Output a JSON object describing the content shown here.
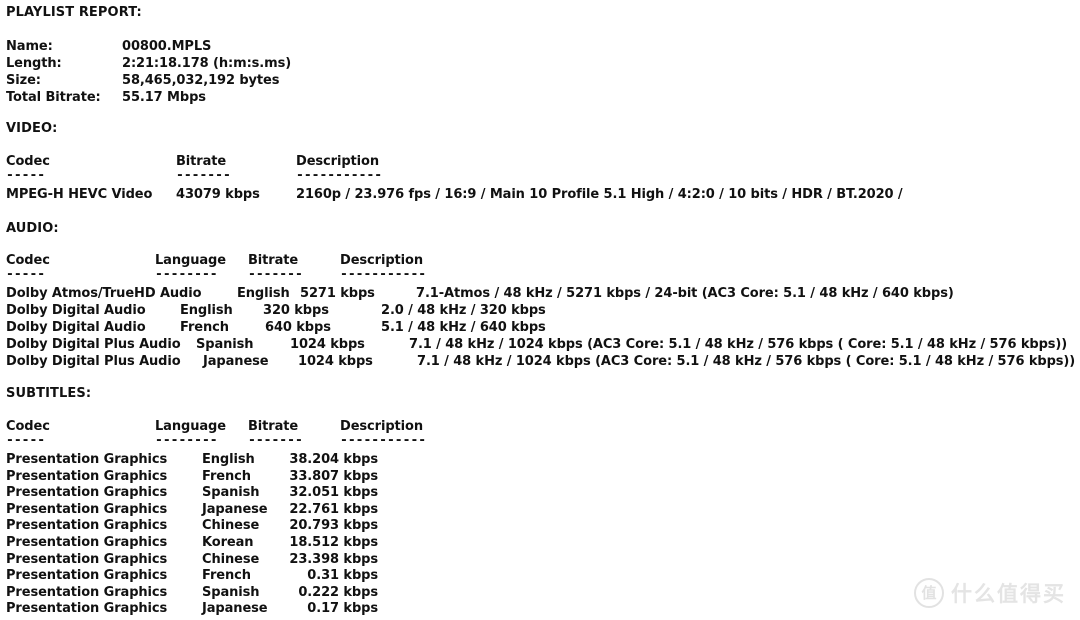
{
  "report": {
    "title": "PLAYLIST REPORT:",
    "info": [
      {
        "label": "Name:",
        "value": "00800.MPLS"
      },
      {
        "label": "Length:",
        "value": "2:21:18.178 (h:m:s.ms)"
      },
      {
        "label": "Size:",
        "value": "58,465,032,192 bytes"
      },
      {
        "label": "Total Bitrate:",
        "value": "55.17 Mbps"
      }
    ],
    "video": {
      "section_label": "VIDEO:",
      "headers": {
        "codec": "Codec",
        "bitrate": "Bitrate",
        "description": "Description"
      },
      "rules": {
        "codec": "-----",
        "bitrate": "-------",
        "description": "-----------"
      },
      "rows": [
        {
          "codec": "MPEG-H HEVC Video",
          "bitrate": "43079 kbps",
          "description": "2160p / 23.976 fps / 16:9 / Main 10 Profile 5.1 High / 4:2:0 / 10 bits / HDR / BT.2020 /"
        }
      ]
    },
    "audio": {
      "section_label": "AUDIO:",
      "headers": {
        "codec": "Codec",
        "language": "Language",
        "bitrate": "Bitrate",
        "description": "Description"
      },
      "rules": {
        "codec": "-----",
        "language": "--------",
        "bitrate": "-------",
        "description": "-----------"
      },
      "rows": [
        {
          "codec": "Dolby Atmos/TrueHD Audio",
          "language": "English",
          "bitrate": "5271 kbps",
          "description": "7.1-Atmos / 48 kHz / 5271 kbps / 24-bit (AC3 Core: 5.1 / 48 kHz / 640 kbps)"
        },
        {
          "codec": "Dolby Digital Audio",
          "language": "English",
          "bitrate": "320 kbps",
          "description": "2.0 / 48 kHz / 320 kbps"
        },
        {
          "codec": "Dolby Digital Audio",
          "language": "French",
          "bitrate": "640 kbps",
          "description": "5.1 / 48 kHz / 640 kbps"
        },
        {
          "codec": "Dolby Digital Plus Audio",
          "language": "Spanish",
          "bitrate": "1024 kbps",
          "description": "7.1 / 48 kHz / 1024 kbps (AC3 Core: 5.1 / 48 kHz / 576 kbps ( Core: 5.1 / 48 kHz / 576 kbps))"
        },
        {
          "codec": "Dolby Digital Plus Audio",
          "language": "Japanese",
          "bitrate": "1024 kbps",
          "description": "7.1 / 48 kHz / 1024 kbps (AC3 Core: 5.1 / 48 kHz / 576 kbps ( Core: 5.1 / 48 kHz / 576 kbps))"
        }
      ]
    },
    "subtitles": {
      "section_label": "SUBTITLES:",
      "headers": {
        "codec": "Codec",
        "language": "Language",
        "bitrate": "Bitrate",
        "description": "Description"
      },
      "rules": {
        "codec": "-----",
        "language": "--------",
        "bitrate": "-------",
        "description": "-----------"
      },
      "rows": [
        {
          "codec": "Presentation Graphics",
          "language": "English",
          "bitrate": "38.204 kbps",
          "description": ""
        },
        {
          "codec": "Presentation Graphics",
          "language": "French",
          "bitrate": "33.807 kbps",
          "description": ""
        },
        {
          "codec": "Presentation Graphics",
          "language": "Spanish",
          "bitrate": "32.051 kbps",
          "description": ""
        },
        {
          "codec": "Presentation Graphics",
          "language": "Japanese",
          "bitrate": "22.761 kbps",
          "description": ""
        },
        {
          "codec": "Presentation Graphics",
          "language": "Chinese",
          "bitrate": "20.793 kbps",
          "description": ""
        },
        {
          "codec": "Presentation Graphics",
          "language": "Korean",
          "bitrate": "18.512 kbps",
          "description": ""
        },
        {
          "codec": "Presentation Graphics",
          "language": "Chinese",
          "bitrate": "23.398 kbps",
          "description": ""
        },
        {
          "codec": "Presentation Graphics",
          "language": "French",
          "bitrate": "0.31 kbps",
          "description": ""
        },
        {
          "codec": "Presentation Graphics",
          "language": "Spanish",
          "bitrate": "0.222 kbps",
          "description": ""
        },
        {
          "codec": "Presentation Graphics",
          "language": "Japanese",
          "bitrate": "0.17 kbps",
          "description": ""
        }
      ]
    }
  },
  "watermark": {
    "badge_glyph": "值",
    "text": "什么值得买",
    "color": "#e4e4e4"
  }
}
